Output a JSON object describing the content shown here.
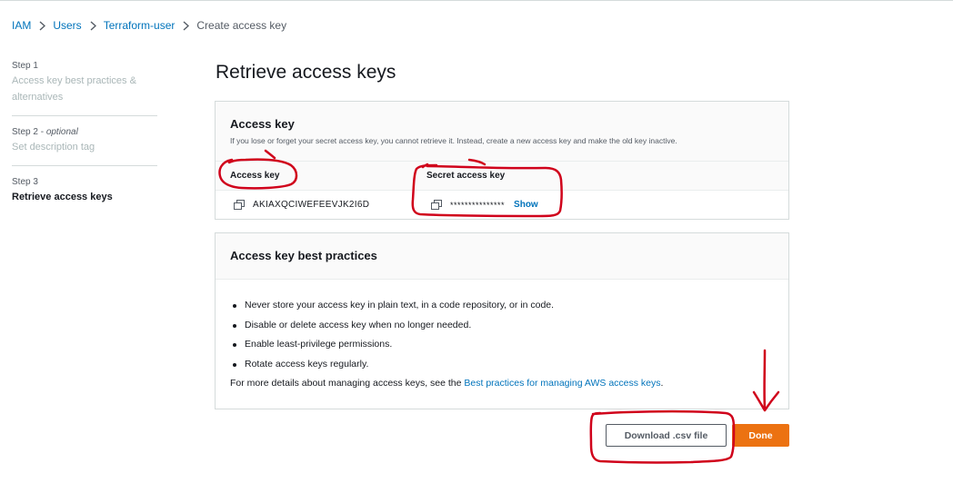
{
  "breadcrumb": {
    "items": [
      "IAM",
      "Users",
      "Terraform-user"
    ],
    "current": "Create access key"
  },
  "steps": [
    {
      "num": "Step 1",
      "title": "Access key best practices & alternatives"
    },
    {
      "num": "Step 2 -",
      "optional": "optional",
      "title": "Set description tag"
    },
    {
      "num": "Step 3",
      "title": "Retrieve access keys"
    }
  ],
  "page_title": "Retrieve access keys",
  "access_key_panel": {
    "title": "Access key",
    "description": "If you lose or forget your secret access key, you cannot retrieve it. Instead, create a new access key and make the old key inactive.",
    "columns": [
      "Access key",
      "Secret access key"
    ],
    "access_key_value": "AKIAXQCIWEFEEVJK2I6D",
    "secret_value": "***************",
    "show_label": "Show"
  },
  "best_practices": {
    "title": "Access key best practices",
    "items": [
      "Never store your access key in plain text, in a code repository, or in code.",
      "Disable or delete access key when no longer needed.",
      "Enable least-privilege permissions.",
      "Rotate access keys regularly."
    ],
    "note_prefix": "For more details about managing access keys, see the ",
    "note_link": "Best practices for managing AWS access keys",
    "note_suffix": "."
  },
  "buttons": {
    "download": "Download .csv file",
    "done": "Done"
  },
  "colors": {
    "link": "#0073bb",
    "primary": "#ec7211",
    "annotation": "#d0021b"
  },
  "icons": [
    "chevron-right-icon",
    "copy-icon"
  ]
}
